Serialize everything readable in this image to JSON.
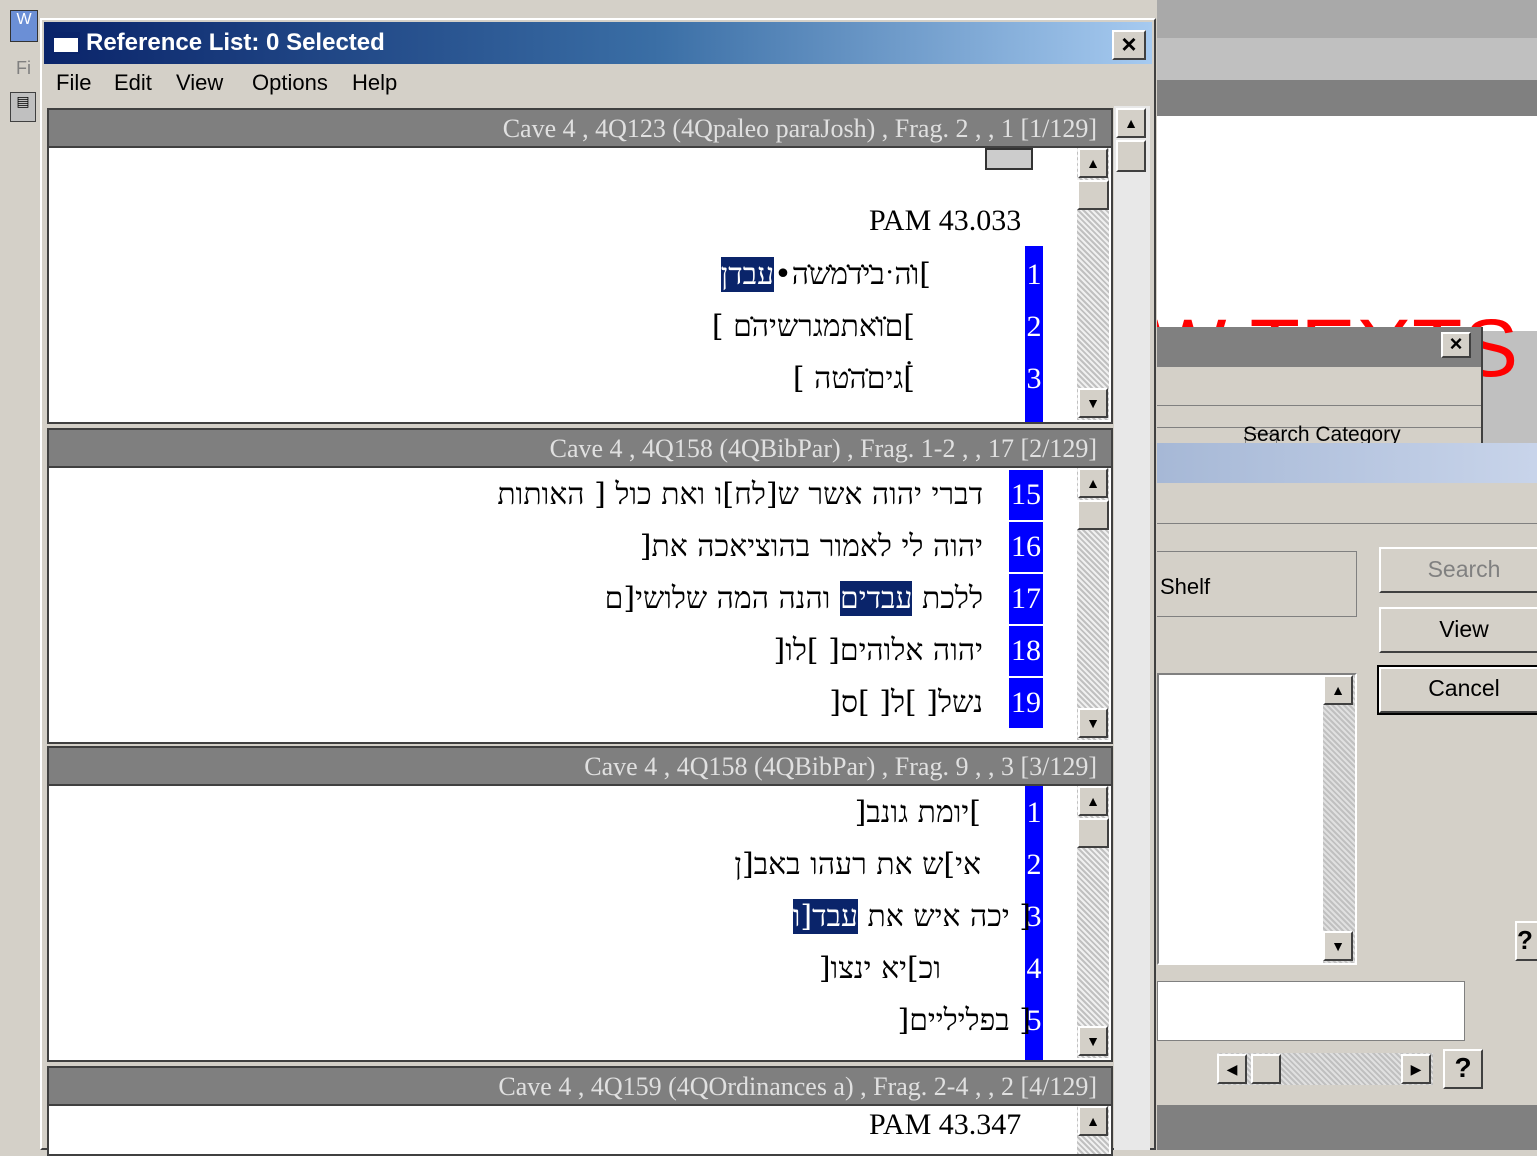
{
  "background": {
    "big_text": "W TEXTS",
    "search_category": "Search Category",
    "shelf_label": "Shelf",
    "buttons": {
      "search": "Search",
      "view": "View",
      "cancel": "Cancel"
    },
    "left_strip_text": "Fi"
  },
  "window": {
    "title": "Reference List:  0 Selected",
    "close_label": "×"
  },
  "menu": [
    "File",
    "Edit",
    "View",
    "Options",
    "Help"
  ],
  "panes": [
    {
      "header": "Cave 4 , 4Q123 (4Qpaleo paraJosh) , Frag. 2 , , 1   [1/129]",
      "pam": "PAM 43.033",
      "lines": [
        {
          "num": "1",
          "pre": "]ו̇ה ̇ב̇י̇ד̇מ̇ש̇ה•",
          "hl": "עבדן",
          "post": ""
        },
        {
          "num": "2",
          "pre": "]ם̇ו̇אתמגרשיה̇ם  ]",
          "hl": "",
          "post": ""
        },
        {
          "num": "3",
          "pre": "]̇גים̇ה̇̇טה          ]",
          "hl": "",
          "post": ""
        }
      ]
    },
    {
      "header": "Cave 4 , 4Q158 (4QBibPar) , Frag. 1-2 , , 17   [2/129]",
      "pam": "",
      "lines": [
        {
          "num": "15",
          "pre": "דברי יהוה אשר ש[לח]ו ואת כול [ האותות",
          "hl": "",
          "post": ""
        },
        {
          "num": "16",
          "pre": "יהוה לי לאמור בהוציאכה את[",
          "hl": "",
          "post": ""
        },
        {
          "num": "17",
          "pre": "ללכת ",
          "hl": "עבדים",
          "post": " והנה המה שלושי[ם"
        },
        {
          "num": "18",
          "pre": "יהוה אלוהים[              ]לו[",
          "hl": "",
          "post": ""
        },
        {
          "num": "19",
          "pre": "נשל[ ]ל[ ]ס[",
          "hl": "",
          "post": ""
        }
      ]
    },
    {
      "header": "Cave 4 , 4Q158 (4QBibPar) , Frag. 9 , , 3   [3/129]",
      "pam": "",
      "lines": [
        {
          "num": "1",
          "pre": "]יומת    גונב[",
          "hl": "",
          "post": ""
        },
        {
          "num": "2",
          "pre": "אי]ש את רעהו באב[ן",
          "hl": "",
          "post": ""
        },
        {
          "num": "3",
          "pre": "[ יכה איש את ",
          "hl": "עבד[ו",
          "post": ""
        },
        {
          "num": "4",
          "pre": "וכ]יא ינצו[",
          "hl": "",
          "post": ""
        },
        {
          "num": "5",
          "pre": "[ בפליליים[",
          "hl": "",
          "post": ""
        }
      ]
    },
    {
      "header": "Cave 4 , 4Q159 (4QOrdinances a) , Frag. 2-4 , , 2   [4/129]",
      "pam": "PAM 43.347",
      "lines": []
    }
  ]
}
